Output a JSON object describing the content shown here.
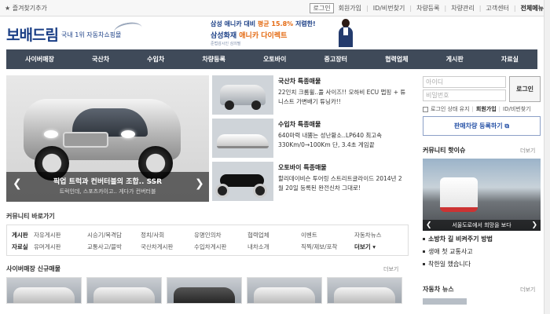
{
  "topbar": {
    "favorite": "★ 즐겨찾기추가",
    "links": [
      "로그인",
      "회원가입",
      "ID/비번찾기",
      "차량등록",
      "차량관리",
      "고객센터",
      "전체메뉴"
    ]
  },
  "header": {
    "logo": "보배드림",
    "tagline": "국내 1위 자동차쇼핑몰",
    "banner_line1_pre": "삼성 애니카 대비",
    "banner_line1_hl": "평균 15.8%",
    "banner_line1_post": "저렴한!",
    "banner_line2_pre": "삼성화재",
    "banner_line2_hl": "애니카 다이렉트",
    "banner_sub": "준법감시인 심의필"
  },
  "nav": [
    "사이버매장",
    "국산차",
    "수입차",
    "차량등록",
    "오토바이",
    "중고장터",
    "협력업체",
    "게시판",
    "자료실"
  ],
  "hero": {
    "title": "픽업 트럭과 컨버터블의 조합.. SSR",
    "subtitle": "트럭인데, 스포츠카이고.. 게다가 컨버터블",
    "prev": "❮",
    "next": "❯"
  },
  "featured": [
    {
      "title": "국산차 특종매물",
      "desc": "22인치 크롬휠..풀 사이즈!! 모하비 ECU 맵핑 + 튜니스트 가변배기 튜닝카!!"
    },
    {
      "title": "수입차 특종매물",
      "desc": "640마력 내뿜는 성난황소..LP640 최고속 330Km/0→100Km 단, 3.4초 게임끝"
    },
    {
      "title": "오토바이 특종매물",
      "desc": "할리데이비슨 투어링 스트리트글라이드 2014년 2월 20일 등록된 완전신차 그대로!"
    }
  ],
  "login": {
    "id_placeholder": "아이디",
    "pw_placeholder": "비밀번호",
    "button": "로그인",
    "keep": "로그인 상태 유지",
    "join": "회원가입",
    "find": "ID/비번찾기",
    "register": "판매차량 등록하기"
  },
  "hot": {
    "title": "커뮤니티 핫이슈",
    "more": "더보기",
    "caption": "서울도로에서 희망을 보다",
    "items": [
      "소방차 길 비켜주기 방법",
      "생애 첫 교통사고",
      "착한일 했습니다"
    ]
  },
  "community": {
    "title": "커뮤니티 바로가기",
    "row1_label": "게시판",
    "row1": [
      "자유게시판",
      "시승기/목격담",
      "정치/사회",
      "유명인의차",
      "협력업체",
      "이벤트",
      "자동차뉴스"
    ],
    "row2_label": "자료실",
    "row2": [
      "유머게시판",
      "교통사고/블박",
      "국산차게시판",
      "수입차게시판",
      "내차소개",
      "직찍/제보/포착"
    ],
    "more": "더보기 ▾"
  },
  "newcars": {
    "title": "사이버매장 신규매물",
    "more": "더보기"
  },
  "side_news": {
    "title": "자동차 뉴스",
    "more": "더보기"
  }
}
